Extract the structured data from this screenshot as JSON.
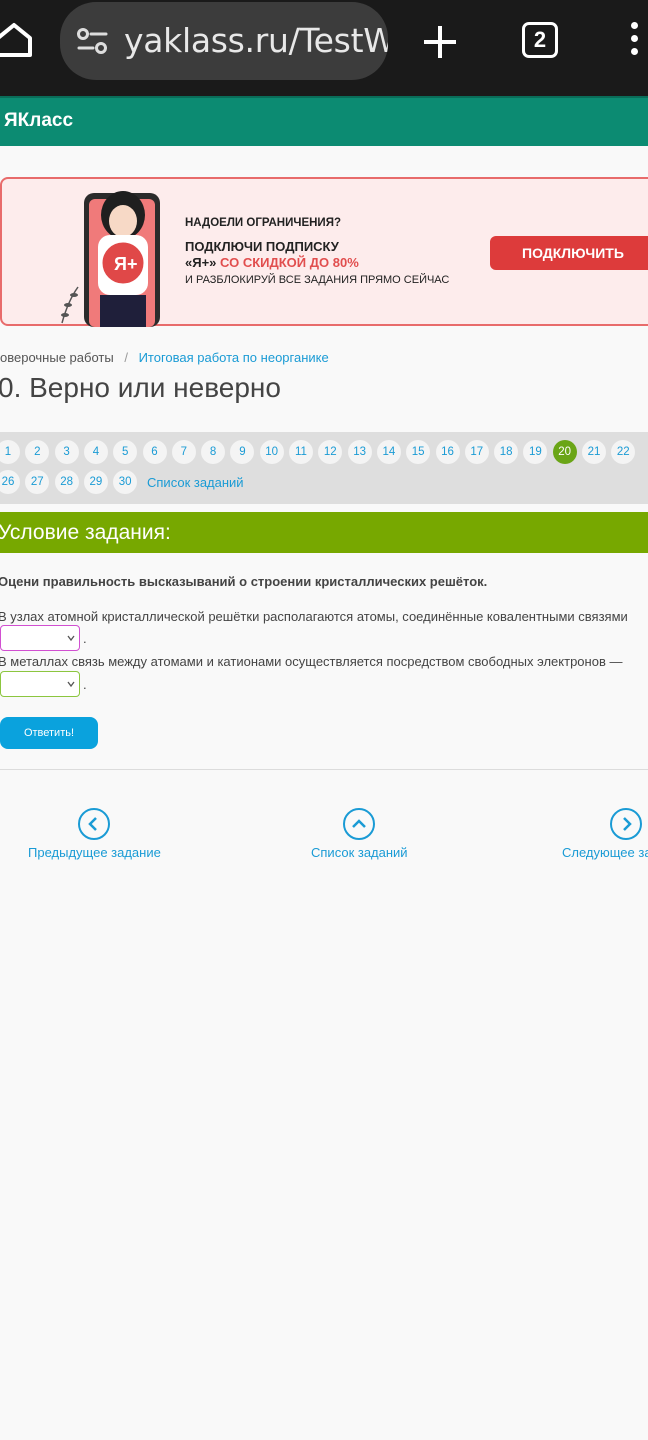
{
  "browser": {
    "url": "yaklass.ru/TestW",
    "tab_count": "2"
  },
  "site": {
    "logo": "ЯКласс"
  },
  "banner": {
    "question": "НАДОЕЛИ ОГРАНИЧЕНИЯ?",
    "line1": "ПОДКЛЮЧИ ПОДПИСКУ",
    "line2_prefix": "«Я+»",
    "line2_highlight": "СО СКИДКОЙ ДО 80%",
    "line3": "И РАЗБЛОКИРУЙ ВСЕ ЗАДАНИЯ ПРЯМО СЕЙЧАС",
    "cta": "ПОДКЛЮЧИТЬ",
    "badge": "Я+"
  },
  "breadcrumb": {
    "prev": "оверочные работы",
    "separator": "/",
    "current": "Итоговая работа по неорганике"
  },
  "page_title": "0. Верно или неверно",
  "pager": {
    "row1": [
      "1",
      "2",
      "3",
      "4",
      "5",
      "6",
      "7",
      "8",
      "9",
      "10",
      "11",
      "12",
      "13",
      "14",
      "15",
      "16",
      "17",
      "18",
      "19",
      "20",
      "21",
      "22"
    ],
    "row2": [
      "26",
      "27",
      "28",
      "29",
      "30"
    ],
    "active": "20",
    "list_link": "Список заданий"
  },
  "condition": {
    "header": "Условие задания:",
    "instruction": "Оцени правильность высказываний о строении кристаллических решёток.",
    "statement1": "В узлах атомной кристаллической решётки располагаются атомы, соединённые ковалентными связями",
    "statement2": "В металлах связь между атомами и катионами осуществляется посредством свободных электронов —",
    "select1_value": "",
    "select2_value": "",
    "period": "."
  },
  "answer_button": "Ответить!",
  "nav": {
    "prev": "Предыдущее задание",
    "list": "Список заданий",
    "next": "Следующее за"
  },
  "colors": {
    "teal_header": "#0c8b72",
    "green_bar": "#77a800",
    "link_blue": "#1a9bd5",
    "active_page": "#6aa516",
    "cta_red": "#dd3b3b",
    "select1_border": "#d14fd1",
    "select2_border": "#8cc63f"
  }
}
